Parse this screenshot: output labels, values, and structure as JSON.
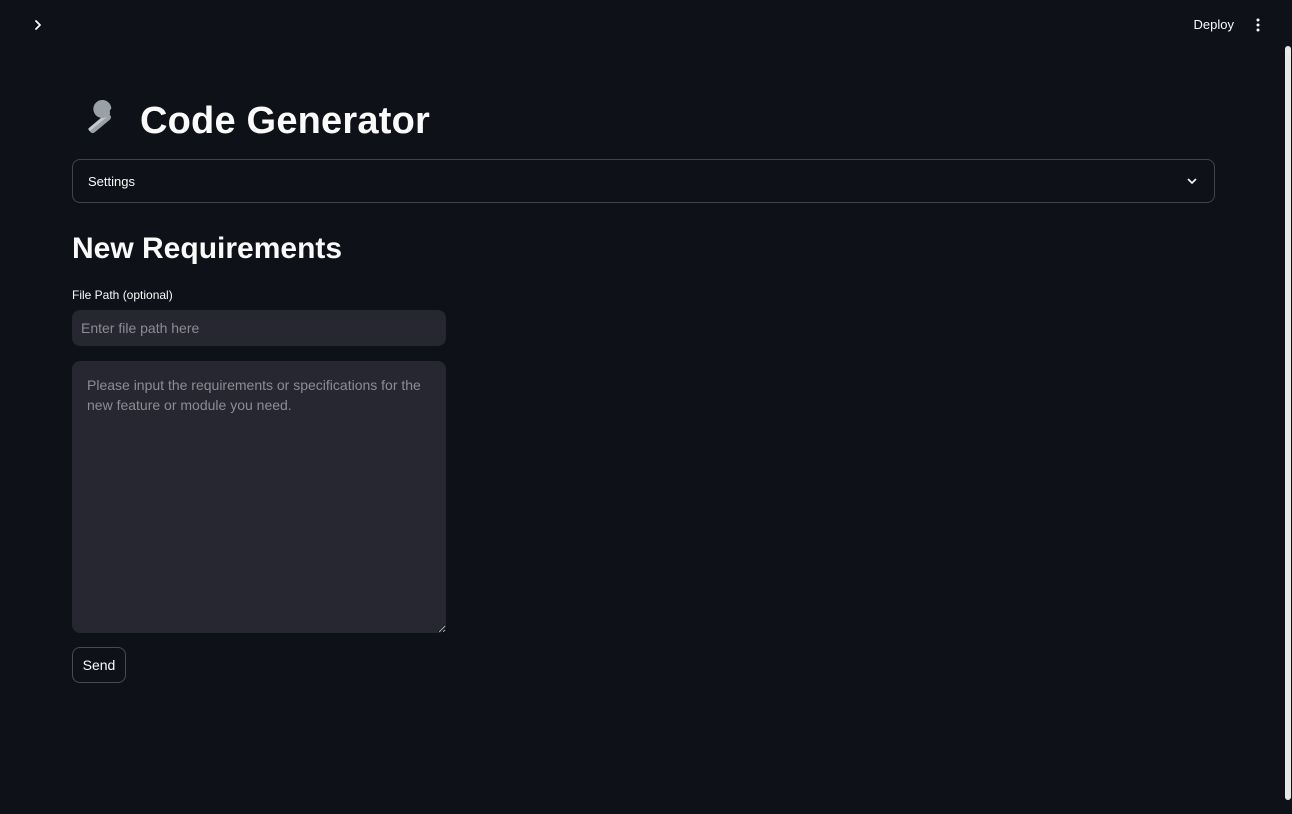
{
  "header": {
    "expand_icon": "chevron-right-icon",
    "deploy_label": "Deploy",
    "menu_icon": "vertical-ellipsis-icon"
  },
  "main": {
    "title_icon": "wrench-icon",
    "title": "Code Generator",
    "settings_expander": {
      "label": "Settings",
      "icon": "chevron-down-icon",
      "expanded": false
    },
    "section_heading": "New Requirements",
    "file_path": {
      "label": "File Path (optional)",
      "value": "",
      "placeholder": "Enter file path here"
    },
    "requirements": {
      "value": "",
      "placeholder": "Please input the requirements or specifications for the new feature or module you need."
    },
    "send_label": "Send"
  },
  "colors": {
    "background": "#0e1117",
    "input_background": "#262730",
    "text": "#fafafa",
    "placeholder": "#8b8d95"
  }
}
